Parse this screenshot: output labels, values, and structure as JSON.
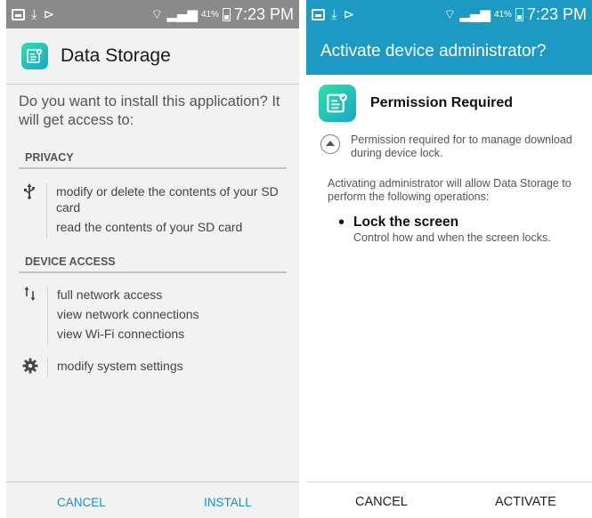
{
  "status_bar": {
    "battery_pct": "41%",
    "time": "7:23 PM"
  },
  "install_screen": {
    "app_name": "Data Storage",
    "question": "Do you want to install this application? It will get access to:",
    "sections": [
      {
        "title": "PRIVACY",
        "groups": [
          {
            "icon": "usb-icon",
            "lines": [
              "modify or delete the contents of your SD card",
              "read the contents of your SD card"
            ]
          }
        ]
      },
      {
        "title": "DEVICE ACCESS",
        "groups": [
          {
            "icon": "network-arrows-icon",
            "lines": [
              "full network access",
              "view network connections",
              "view Wi-Fi connections"
            ]
          },
          {
            "icon": "gear-icon",
            "lines": [
              "modify system settings"
            ]
          }
        ]
      }
    ],
    "buttons": {
      "cancel": "CANCEL",
      "install": "INSTALL"
    }
  },
  "admin_screen": {
    "title": "Activate device administrator?",
    "permission_title": "Permission Required",
    "permission_text": "Permission required for to manage download during device lock.",
    "activating_text": "Activating administrator will allow Data Storage to perform the following operations:",
    "operation": {
      "title": "Lock the screen",
      "description": "Control how and when the screen locks."
    },
    "buttons": {
      "cancel": "CANCEL",
      "activate": "ACTIVATE"
    }
  },
  "colors": {
    "accent": "#1d9ac3",
    "status_gray": "#8a8a8a",
    "link_blue": "#1d8fc0"
  }
}
